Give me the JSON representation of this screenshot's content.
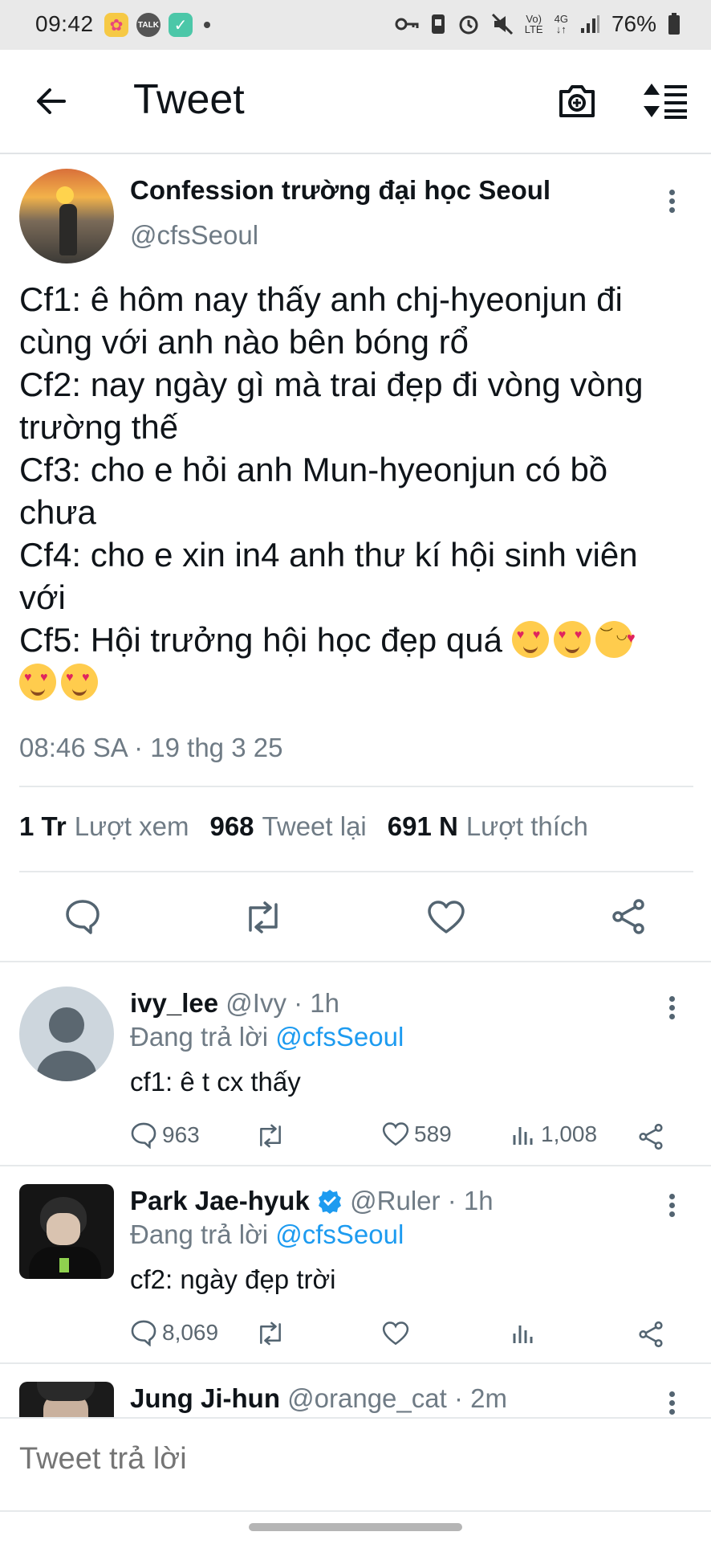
{
  "status_bar": {
    "time": "09:42",
    "signal": "Vo) LTE 4G",
    "battery": "76%"
  },
  "header": {
    "title": "Tweet"
  },
  "tweet": {
    "author_name": "Confession trường đại học Seoul",
    "author_handle": "@cfsSeoul",
    "lines": [
      "Cf1: ê hôm nay thấy anh chj-hyeonjun đi cùng với anh nào bên bóng rổ",
      "Cf2: nay ngày gì mà trai đẹp đi vòng vòng trường thế",
      "Cf3: cho e hỏi anh Mun-hyeonjun có bồ chưa",
      "Cf4: cho e xin in4 anh thư kí hội sinh viên với",
      "Cf5: Hội trưởng hội học đẹp quá"
    ],
    "timestamp": "08:46 SA · 19 thg 3 25",
    "views_count": "1 Tr",
    "views_label": "Lượt xem",
    "retweets_count": "968",
    "retweets_label": "Tweet lại",
    "likes_count": "691 N",
    "likes_label": "Lượt thích"
  },
  "replies": [
    {
      "name": "ivy_lee",
      "handle": "@Ivy",
      "time": "· 1h",
      "replying_prefix": "Đang trả lời",
      "replying_to": "@cfsSeoul",
      "text": "cf1: ê t cx thấy",
      "reply_count": "963",
      "like_count": "589",
      "view_count": "1,008"
    },
    {
      "name": "Park Jae-hyuk",
      "handle": "@Ruler",
      "time": "· 1h",
      "replying_prefix": "Đang trả lời",
      "replying_to": "@cfsSeoul",
      "text": "cf2: ngày đẹp trời",
      "reply_count": "8,069",
      "like_count": "",
      "view_count": ""
    },
    {
      "name": "Jung Ji-hun",
      "handle": "@orange_cat",
      "time": "· 2m"
    }
  ],
  "composer": {
    "placeholder": "Tweet trả lời"
  },
  "colors": {
    "accent": "#1d9bf0",
    "muted": "#6f7b85",
    "verified": "#1d9bf0"
  }
}
